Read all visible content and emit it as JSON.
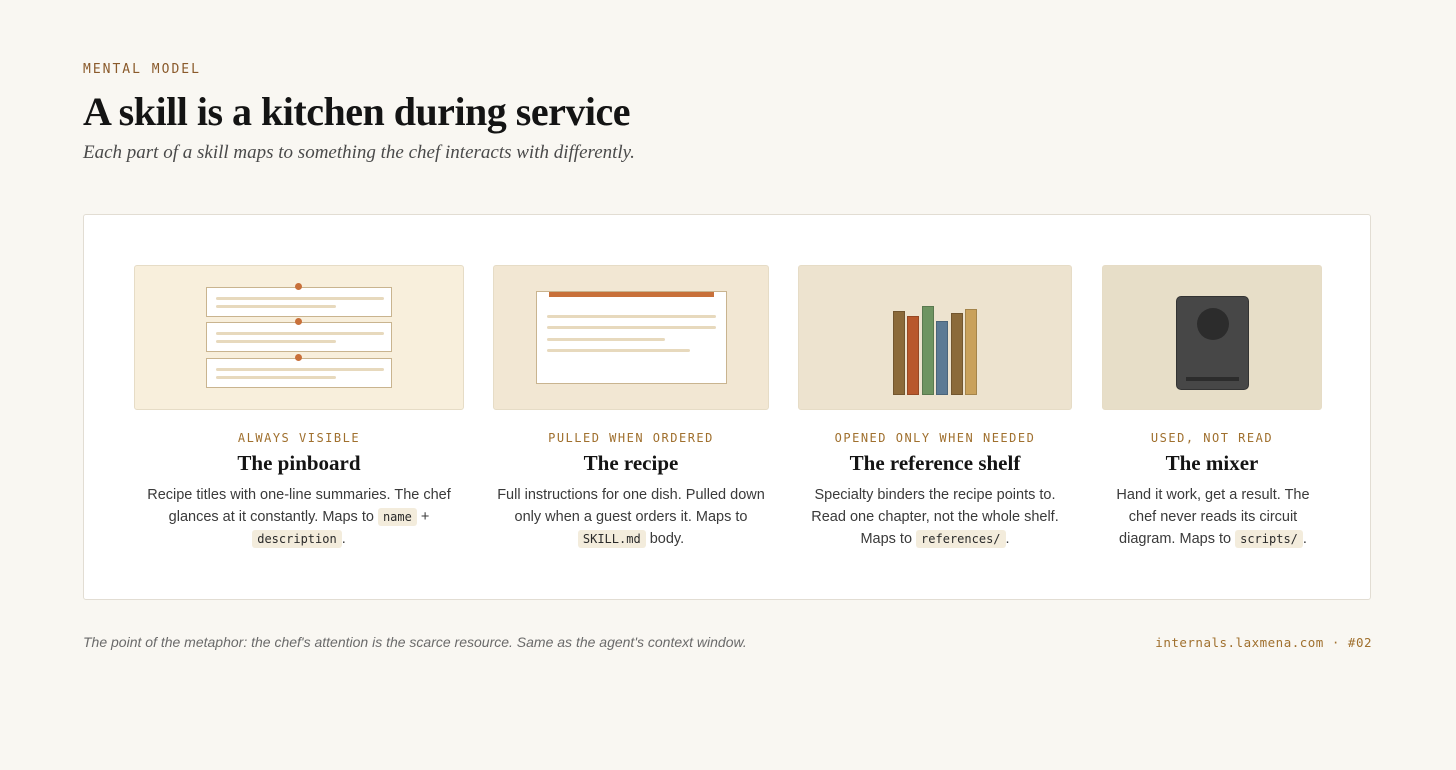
{
  "header": {
    "eyebrow": "MENTAL MODEL",
    "title": "A skill is a kitchen during service",
    "subtitle": "Each part of a skill maps to something the chef interacts with differently."
  },
  "cards": [
    {
      "label": "ALWAYS VISIBLE",
      "name": "The pinboard",
      "desc_a": "Recipe titles with one-line summaries. The chef glances at it constantly. Maps to ",
      "code_a": "name",
      "desc_b": " + ",
      "code_b": "description",
      "desc_c": ".",
      "illustration": "pinboard-icon",
      "bg": "#f8efdc"
    },
    {
      "label": "PULLED WHEN ORDERED",
      "name": "The recipe",
      "desc_a": "Full instructions for one dish. Pulled down only when a guest orders it. Maps to ",
      "code_a": "SKILL.md",
      "desc_b": " body.",
      "illustration": "recipe-icon",
      "bg": "#f2e7d3"
    },
    {
      "label": "OPENED ONLY WHEN NEEDED",
      "name": "The reference shelf",
      "desc_a": "Specialty binders the recipe points to. Read one chapter, not the whole shelf. Maps to ",
      "code_a": "references/",
      "desc_b": ".",
      "illustration": "bookshelf-icon",
      "bg": "#ede3cf",
      "book_colors": [
        "#8b6a3a",
        "#b8582c",
        "#6e9461",
        "#5c7a94",
        "#8b6a3a",
        "#c9a15b"
      ]
    },
    {
      "label": "USED, NOT READ",
      "name": "The mixer",
      "desc_a": "Hand it work, get a result. The chef never reads its circuit diagram. Maps to ",
      "code_a": "scripts/",
      "desc_b": ".",
      "illustration": "mixer-icon",
      "bg": "#e7dec8"
    }
  ],
  "footer": {
    "note": "The point of the metaphor: the chef's attention is the scarce resource. Same as the agent's context window.",
    "source": "internals.laxmena.com · #02"
  },
  "colors": {
    "accent": "#c8703a",
    "label": "#a0702e",
    "background": "#f9f7f2"
  }
}
